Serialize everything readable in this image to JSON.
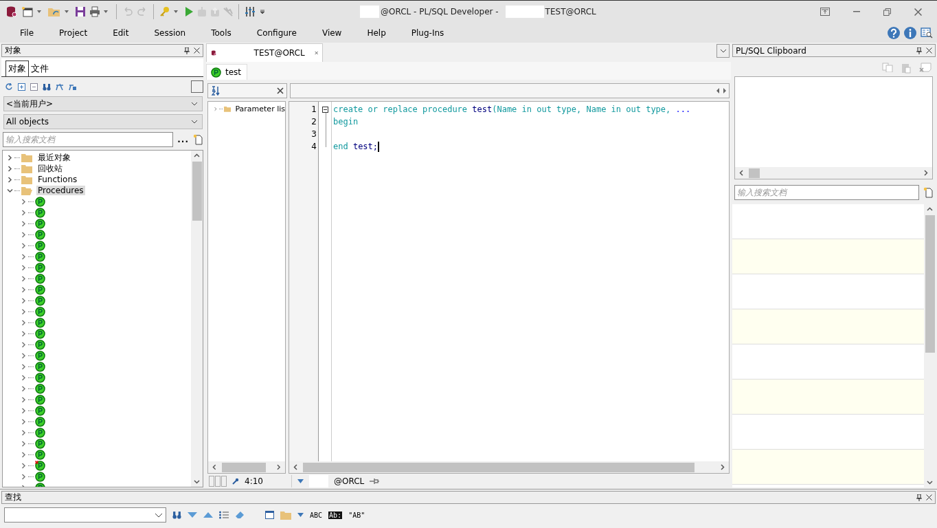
{
  "window": {
    "title_left": "@ORCL - PL/SQL Developer -",
    "title_right": "TEST@ORCL"
  },
  "menu": [
    "File",
    "Project",
    "Edit",
    "Session",
    "Tools",
    "Configure",
    "View",
    "Help",
    "Plug-Ins"
  ],
  "object_panel": {
    "title": "对象",
    "tabs": [
      {
        "label": "对象",
        "selected": true
      },
      {
        "label": "文件",
        "selected": false
      }
    ],
    "user_select": "<当前用户>",
    "filter_select": "All objects",
    "search": {
      "placeholder": "输入搜索文档"
    },
    "more": "...",
    "tree": [
      {
        "label": "最近对象",
        "expanded": false,
        "selected": false
      },
      {
        "label": "回收站",
        "expanded": false,
        "selected": false
      },
      {
        "label": "Functions",
        "expanded": false,
        "selected": false
      },
      {
        "label": "Procedures",
        "expanded": true,
        "selected": true,
        "children": [
          {
            "invalid": false
          },
          {
            "invalid": false
          },
          {
            "invalid": false
          },
          {
            "invalid": false
          },
          {
            "invalid": false
          },
          {
            "invalid": false
          },
          {
            "invalid": false
          },
          {
            "invalid": false
          },
          {
            "invalid": false
          },
          {
            "invalid": false
          },
          {
            "invalid": false
          },
          {
            "invalid": false
          },
          {
            "invalid": false
          },
          {
            "invalid": false
          },
          {
            "invalid": false
          },
          {
            "invalid": false
          },
          {
            "invalid": false
          },
          {
            "invalid": false
          },
          {
            "invalid": false
          },
          {
            "invalid": false
          },
          {
            "invalid": false
          },
          {
            "invalid": false
          },
          {
            "invalid": false
          },
          {
            "invalid": false
          },
          {
            "invalid": true
          },
          {
            "invalid": false
          },
          {
            "invalid": false
          }
        ]
      }
    ]
  },
  "editor": {
    "tab": "TEST@ORCL",
    "subtab": "test",
    "outline": [
      {
        "label": "Parameter lis",
        "expanded": false
      }
    ],
    "lines": [
      {
        "number": "1",
        "tokens": [
          {
            "text": "create or replace procedure ",
            "kind": "keyword"
          },
          {
            "text": "test",
            "kind": "name"
          },
          {
            "text": "(Name in out type, Name in out type, ",
            "kind": "keyword"
          },
          {
            "text": "...",
            "kind": "ellipsis"
          }
        ]
      },
      {
        "number": "2",
        "tokens": [
          {
            "text": "begin",
            "kind": "keyword"
          }
        ]
      },
      {
        "number": "3"
      },
      {
        "number": "4",
        "tokens": [
          {
            "text": "end ",
            "kind": "keyword"
          },
          {
            "text": "test;",
            "kind": "name"
          }
        ]
      }
    ],
    "status": {
      "position": "4:10",
      "connection": "@ORCL"
    }
  },
  "clipboard": {
    "title": "PL/SQL Clipboard",
    "search": {
      "placeholder": "输入搜索文档"
    }
  },
  "find": {
    "title": "查找",
    "labels": [
      "ABC",
      "Ab:",
      "\"AB\""
    ]
  }
}
